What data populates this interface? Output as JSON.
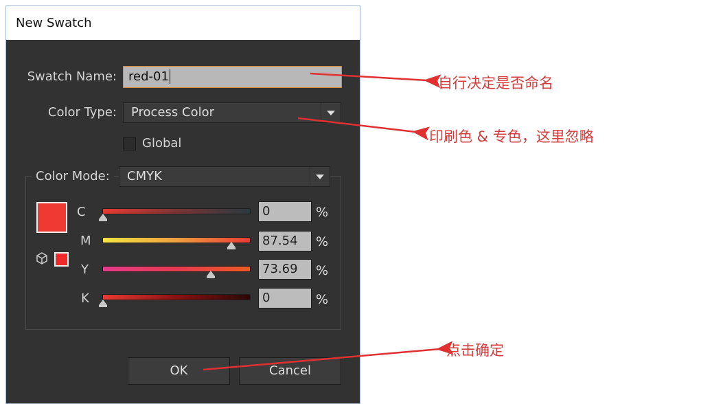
{
  "dialog": {
    "title": "New Swatch",
    "swatch_name": {
      "label": "Swatch Name:",
      "value": "red-01"
    },
    "color_type": {
      "label": "Color Type:",
      "value": "Process Color"
    },
    "global": {
      "label": "Global",
      "checked": false
    },
    "color_mode": {
      "label": "Color Mode:",
      "value": "CMYK"
    },
    "swatch_color": "#ee3a33",
    "channels": [
      {
        "letter": "C",
        "value": "0",
        "unit": "%"
      },
      {
        "letter": "M",
        "value": "87.54",
        "unit": "%"
      },
      {
        "letter": "Y",
        "value": "73.69",
        "unit": "%"
      },
      {
        "letter": "K",
        "value": "0",
        "unit": "%"
      }
    ],
    "buttons": {
      "ok": "OK",
      "cancel": "Cancel"
    }
  },
  "annotations": {
    "name": "自行决定是否命名",
    "type": "印刷色 & 专色，这里忽略",
    "ok": "点击确定",
    "color": "#d43c3c"
  }
}
